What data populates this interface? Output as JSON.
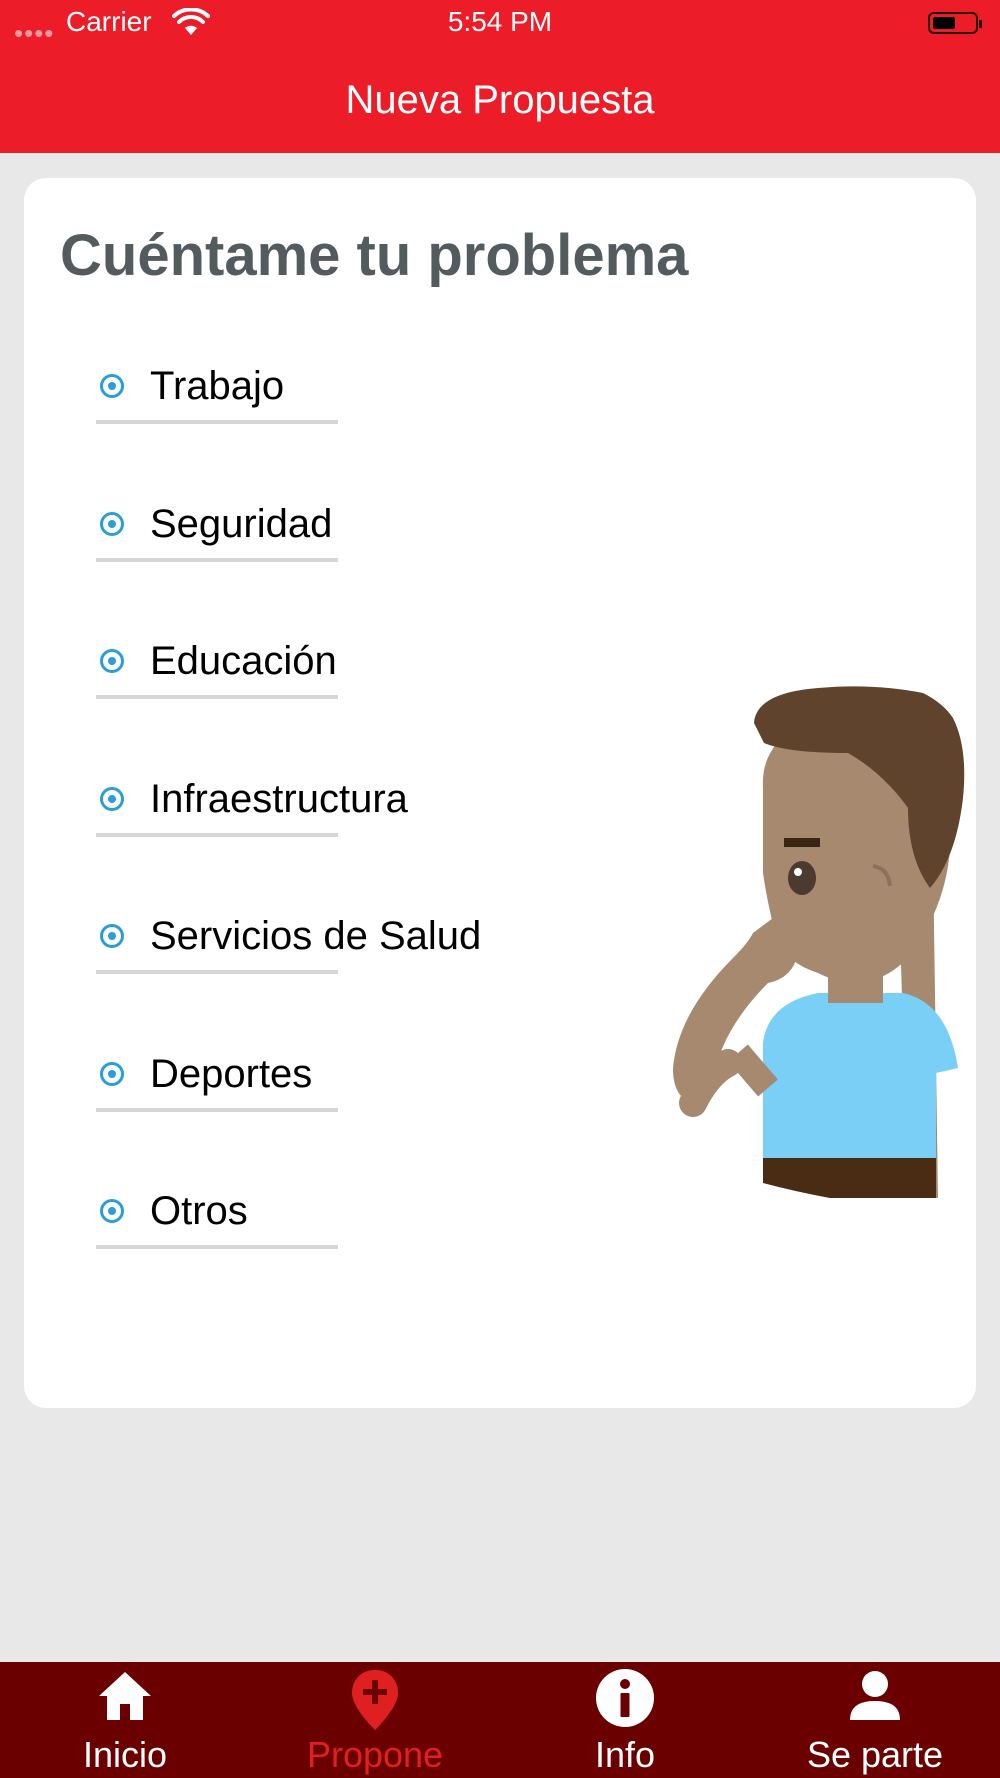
{
  "status_bar": {
    "carrier": "Carrier",
    "time": "5:54 PM",
    "battery_level": 0.55
  },
  "header": {
    "title": "Nueva Propuesta"
  },
  "card": {
    "title": "Cuéntame tu problema",
    "options": [
      {
        "label": "Trabajo"
      },
      {
        "label": "Seguridad"
      },
      {
        "label": "Educación"
      },
      {
        "label": "Infraestructura"
      },
      {
        "label": "Servicios de Salud"
      },
      {
        "label": "Deportes"
      },
      {
        "label": "Otros"
      }
    ]
  },
  "tab_bar": {
    "tabs": [
      {
        "label": "Inicio",
        "icon": "home-icon"
      },
      {
        "label": "Propone",
        "icon": "map-pin-plus-icon",
        "active": true
      },
      {
        "label": "Info",
        "icon": "info-icon"
      },
      {
        "label": "Se parte",
        "icon": "user-icon"
      }
    ]
  },
  "colors": {
    "header": "#ec1c28",
    "tab_bar": "#6b0000",
    "active_tab": "#e02020",
    "radio": "#2a9fd6",
    "title_text": "#545b5f",
    "background": "#e8e8e8"
  }
}
